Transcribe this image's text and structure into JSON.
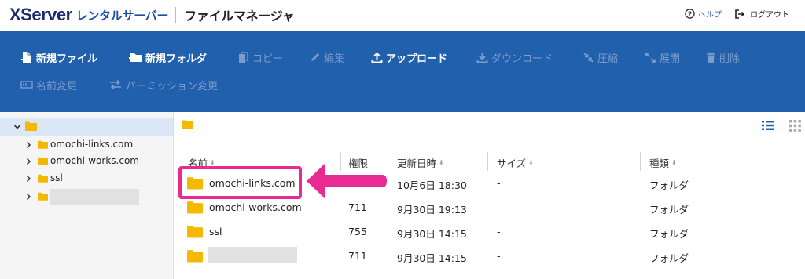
{
  "header": {
    "brand_main": "XServer",
    "brand_sub": "レンタルサーバー",
    "app_name": "ファイルマネージャ",
    "help_label": "ヘルプ",
    "logout_label": "ログアウト"
  },
  "toolbar": {
    "row1": [
      {
        "label": "新規ファイル",
        "icon": "new-file-icon",
        "enabled": true
      },
      {
        "label": "新規フォルダ",
        "icon": "new-folder-icon",
        "enabled": true
      },
      {
        "label": "コピー",
        "icon": "copy-icon",
        "enabled": false
      },
      {
        "label": "編集",
        "icon": "pencil-icon",
        "enabled": false
      },
      {
        "label": "アップロード",
        "icon": "upload-icon",
        "enabled": true
      },
      {
        "label": "ダウンロード",
        "icon": "download-icon",
        "enabled": false
      },
      {
        "label": "圧縮",
        "icon": "compress-icon",
        "enabled": false
      },
      {
        "label": "展開",
        "icon": "expand-icon",
        "enabled": false
      },
      {
        "label": "削除",
        "icon": "trash-icon",
        "enabled": false
      }
    ],
    "row2": [
      {
        "label": "名前変更",
        "icon": "rename-icon",
        "enabled": false
      },
      {
        "label": "パーミッション変更",
        "icon": "permission-icon",
        "enabled": false
      }
    ]
  },
  "tree": {
    "items": [
      {
        "name": "omochi-links.com"
      },
      {
        "name": "omochi-works.com"
      },
      {
        "name": "ssl"
      },
      {
        "name": ""
      }
    ]
  },
  "table": {
    "columns": {
      "name": "名前",
      "permission": "権限",
      "modified": "更新日時",
      "size": "サイズ",
      "type": "種類"
    },
    "rows": [
      {
        "name": "omochi-links.com",
        "permission": "",
        "modified": "10月6日 18:30",
        "size": "-",
        "type": "フォルダ"
      },
      {
        "name": "omochi-works.com",
        "permission": "711",
        "modified": "9月30日 19:13",
        "size": "-",
        "type": "フォルダ"
      },
      {
        "name": "ssl",
        "permission": "755",
        "modified": "9月30日 14:15",
        "size": "-",
        "type": "フォルダ"
      },
      {
        "name": "",
        "permission": "711",
        "modified": "9月30日 14:15",
        "size": "-",
        "type": "フォルダ"
      }
    ]
  },
  "colors": {
    "toolbar_bg": "#2160ad",
    "folder": "#f5b800",
    "highlight": "#ea2a93",
    "selected_tree": "#dbe7f7"
  }
}
